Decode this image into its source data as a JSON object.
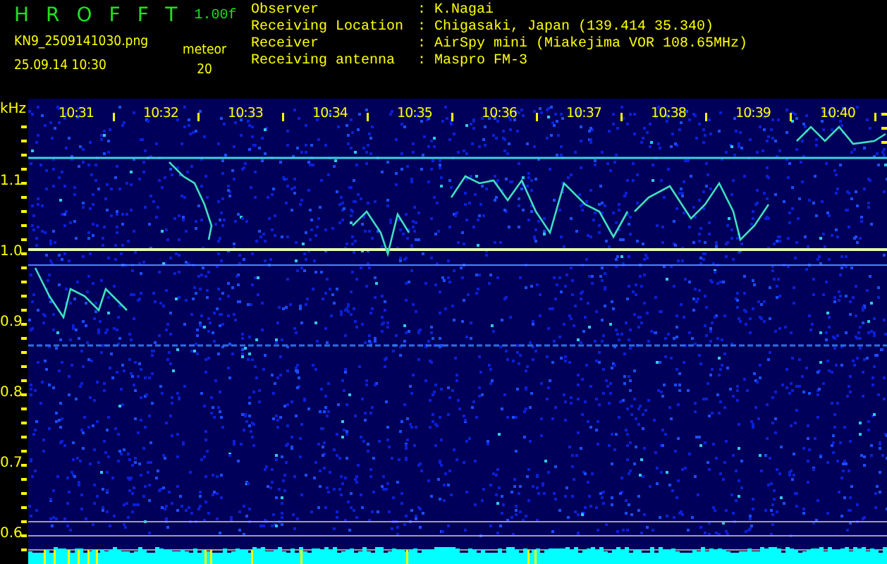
{
  "app": {
    "title": "HROFFT",
    "version": "1.00f"
  },
  "file": {
    "name": "KN9_2509141030.png",
    "datetime": "25.09.14  10:30"
  },
  "mode": {
    "label": "meteor",
    "value": "20"
  },
  "info": [
    {
      "label": "Observer",
      "value": ": K.Nagai"
    },
    {
      "label": "Receiving Location",
      "value": ": Chigasaki, Japan (139.414 35.340)"
    },
    {
      "label": "Receiver",
      "value": ": AirSpy mini (Miakejima VOR 108.65MHz)"
    },
    {
      "label": "Receiving antenna",
      "value": ": Maspro FM-3"
    }
  ],
  "plot": {
    "y_unit": "kHz",
    "y_labels": [
      "1.1",
      "1.0",
      "0.9",
      "0.8",
      "0.7",
      "0.6"
    ],
    "time_labels": [
      "10:31",
      "10:32",
      "10:33",
      "10:34",
      "10:35",
      "10:36",
      "10:37",
      "10:38",
      "10:39",
      "10:40"
    ]
  }
}
